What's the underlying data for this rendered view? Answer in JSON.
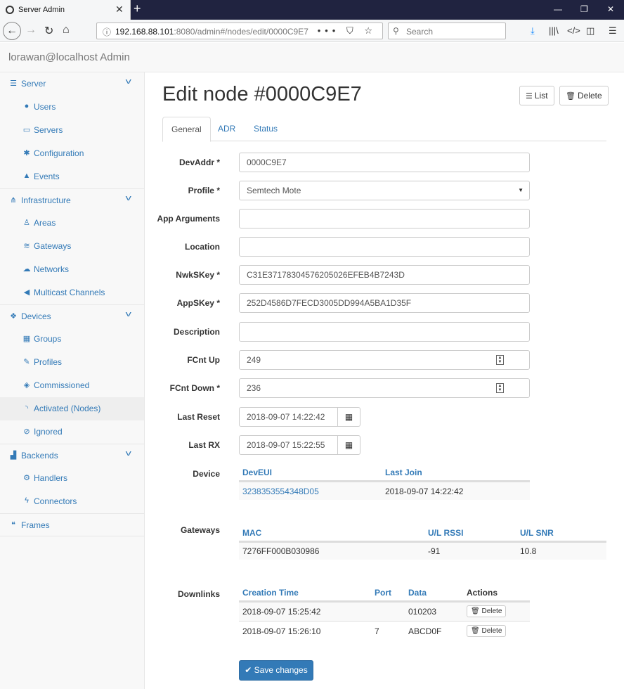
{
  "browser": {
    "tab_title": "Server Admin",
    "tab_close": "✕",
    "new_tab": "+",
    "url_host": "192.168.88.101",
    "url_rest": ":8080/admin#/nodes/edit/0000C9E7",
    "search_placeholder": "Search",
    "url_actions": "••• ⛉ ☆",
    "minimize": "—",
    "restore": "❐",
    "close": "✕"
  },
  "app": {
    "brand": "lorawan@localhost Admin"
  },
  "sidebar": {
    "groups": [
      {
        "label": "Server",
        "icon": "server-icon",
        "items": [
          {
            "label": "Users",
            "icon": "user-icon"
          },
          {
            "label": "Servers",
            "icon": "monitor-icon"
          },
          {
            "label": "Configuration",
            "icon": "cog-icon"
          },
          {
            "label": "Events",
            "icon": "warning-icon"
          }
        ]
      },
      {
        "label": "Infrastructure",
        "icon": "sitemap-icon",
        "items": [
          {
            "label": "Areas",
            "icon": "person-icon"
          },
          {
            "label": "Gateways",
            "icon": "wifi-icon"
          },
          {
            "label": "Networks",
            "icon": "cloud-icon"
          },
          {
            "label": "Multicast Channels",
            "icon": "bullhorn-icon"
          }
        ]
      },
      {
        "label": "Devices",
        "icon": "cubes-icon",
        "items": [
          {
            "label": "Groups",
            "icon": "grid-icon"
          },
          {
            "label": "Profiles",
            "icon": "edit-icon"
          },
          {
            "label": "Commissioned",
            "icon": "cube-icon"
          },
          {
            "label": "Activated (Nodes)",
            "icon": "rss-icon",
            "active": true
          },
          {
            "label": "Ignored",
            "icon": "ban-icon"
          }
        ]
      },
      {
        "label": "Backends",
        "icon": "chart-icon",
        "items": [
          {
            "label": "Handlers",
            "icon": "cogs-icon"
          },
          {
            "label": "Connectors",
            "icon": "bolt-icon"
          }
        ]
      },
      {
        "label": "Frames",
        "icon": "comments-icon",
        "items": []
      }
    ]
  },
  "page": {
    "title": "Edit node #0000C9E7",
    "list_label": "List",
    "delete_label": "Delete",
    "tabs": [
      "General",
      "ADR",
      "Status"
    ]
  },
  "form": {
    "devaddr_label": "DevAddr *",
    "devaddr": "0000C9E7",
    "profile_label": "Profile *",
    "profile": "Semtech Mote",
    "app_args_label": "App Arguments",
    "app_args": "",
    "location_label": "Location",
    "location": "",
    "nwkskey_label": "NwkSKey *",
    "nwkskey": "C31E37178304576205026EFEB4B7243D",
    "appskey_label": "AppSKey *",
    "appskey": "252D4586D7FECD3005DD994A5BA1D35F",
    "description_label": "Description",
    "description": "",
    "fcnt_up_label": "FCnt Up",
    "fcnt_up": "249",
    "fcnt_down_label": "FCnt Down *",
    "fcnt_down": "236",
    "last_reset_label": "Last Reset",
    "last_reset": "2018-09-07 14:22:42",
    "last_rx_label": "Last RX",
    "last_rx": "2018-09-07 15:22:55"
  },
  "device": {
    "label": "Device",
    "headers": [
      "DevEUI",
      "Last Join"
    ],
    "row": [
      "3238353554348D05",
      "2018-09-07 14:22:42"
    ]
  },
  "gateways": {
    "label": "Gateways",
    "headers": [
      "MAC",
      "U/L RSSI",
      "U/L SNR"
    ],
    "row": [
      "7276FF000B030986",
      "-91",
      "10.8"
    ]
  },
  "downlinks": {
    "label": "Downlinks",
    "headers": [
      "Creation Time",
      "Port",
      "Data",
      "Actions"
    ],
    "rows": [
      {
        "time": "2018-09-07 15:25:42",
        "port": "",
        "data": "010203",
        "action": "Delete"
      },
      {
        "time": "2018-09-07 15:26:10",
        "port": "7",
        "data": "ABCD0F",
        "action": "Delete"
      }
    ]
  },
  "save_label": "Save changes"
}
